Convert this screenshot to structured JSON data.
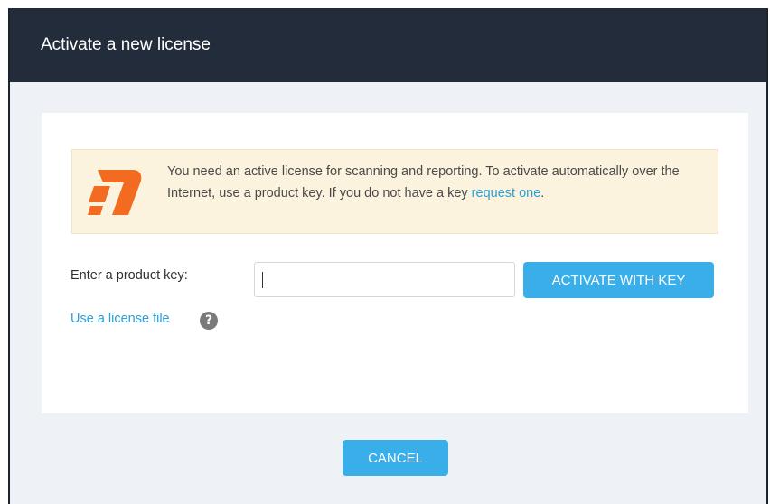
{
  "dialog": {
    "title": "Activate a new license"
  },
  "notice": {
    "text_before_link": "You need an active license for scanning and reporting. To activate automatically over the Internet, use a product key. If you do not have a key ",
    "link_text": "request one",
    "text_after_link": ".",
    "logo_icon": "rapid7-logo-icon",
    "logo_color": "#f26b21"
  },
  "form": {
    "product_key_label": "Enter a product key:",
    "product_key_value": "",
    "activate_button_label": "ACTIVATE WITH KEY",
    "license_file_link": "Use a license file",
    "help_icon": "question-circle-icon",
    "help_glyph": "?"
  },
  "footer": {
    "cancel_button_label": "CANCEL"
  },
  "colors": {
    "accent": "#3aaee8",
    "titlebar": "#232c3a",
    "notice_bg": "#fcf3de",
    "link": "#2a9fd8"
  }
}
